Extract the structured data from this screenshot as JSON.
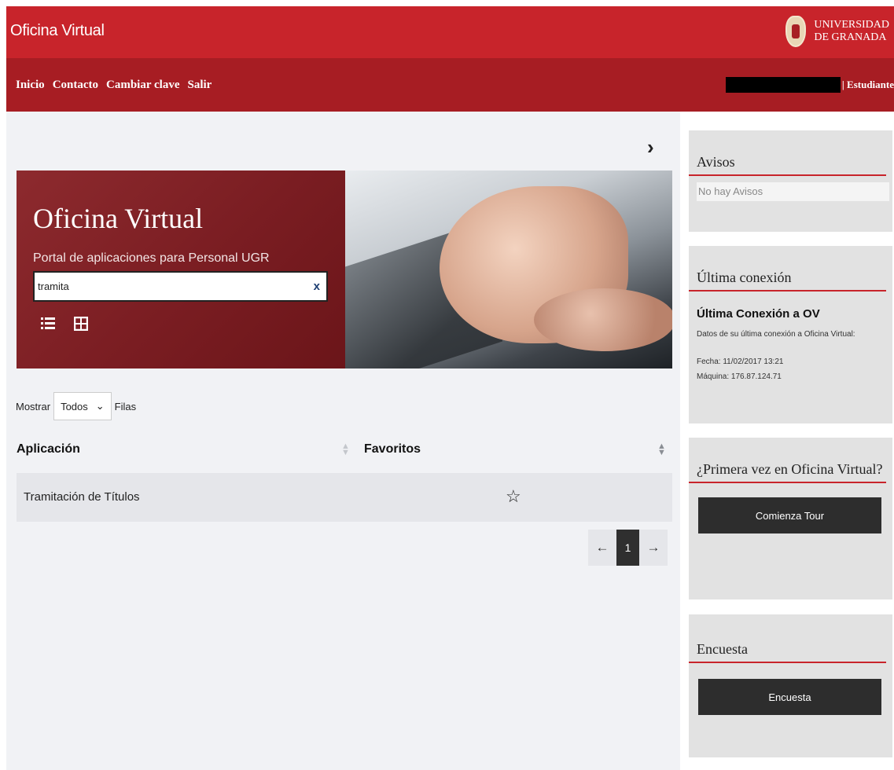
{
  "header": {
    "app_title": "Oficina Virtual",
    "logo_line1": "UNIVERSIDAD",
    "logo_line2": "DE GRANADA"
  },
  "nav": {
    "links": [
      "Inicio",
      "Contacto",
      "Cambiar clave",
      "Salir"
    ],
    "user_role": "| Estudiante"
  },
  "hero": {
    "title": "Oficina Virtual",
    "subtitle": "Portal de aplicaciones para Personal UGR",
    "search_value": "tramita",
    "clear_label": "x"
  },
  "table_controls": {
    "show_label": "Mostrar",
    "show_value": "Todos",
    "rows_label": "Filas"
  },
  "table": {
    "columns": [
      "Aplicación",
      "Favoritos"
    ],
    "rows": [
      {
        "app": "Tramitación de Títulos",
        "favorite": false
      }
    ]
  },
  "pagination": {
    "prev": "←",
    "current": "1",
    "next": "→"
  },
  "sidebar": {
    "avisos": {
      "title": "Avisos",
      "message": "No hay Avisos"
    },
    "ultima": {
      "title": "Última conexión",
      "heading": "Última Conexión a OV",
      "description": "Datos de su última conexión a Oficina Virtual:",
      "fecha": "Fecha: 11/02/2017 13:21",
      "maquina": "Máquina: 176.87.124.71"
    },
    "tour": {
      "title": "¿Primera vez en Oficina Virtual?",
      "button": "Comienza Tour"
    },
    "encuesta": {
      "title": "Encuesta",
      "button": "Encuesta"
    }
  },
  "colors": {
    "primary_red": "#c8242b",
    "dark_red": "#a71d23",
    "dark_button": "#2d2d2d"
  }
}
